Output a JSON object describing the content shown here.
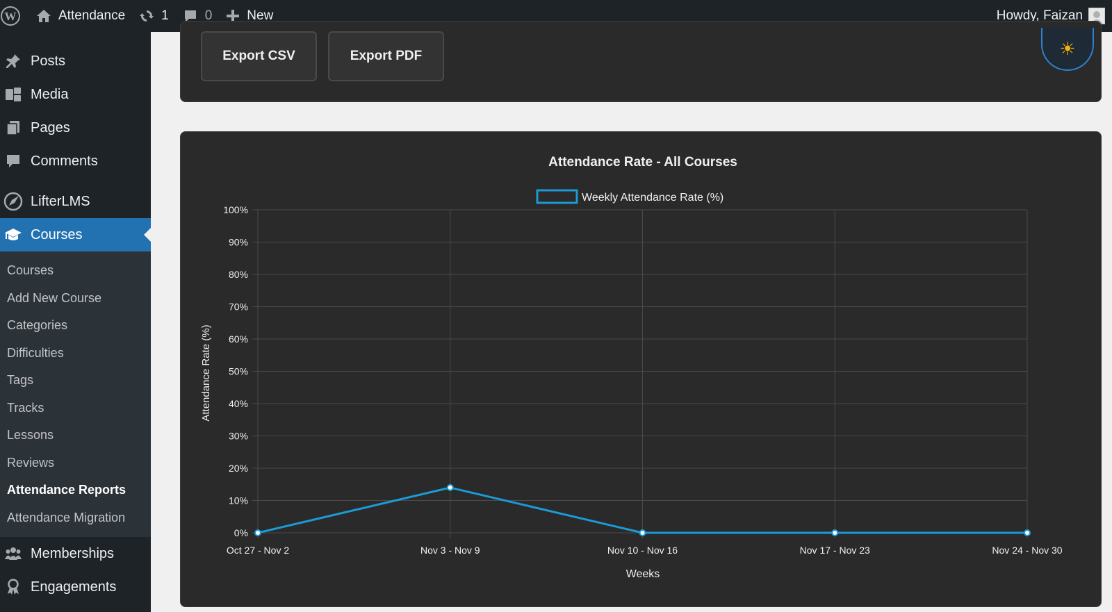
{
  "adminbar": {
    "site_name": "Attendance",
    "updates_count": "1",
    "comments_count": "0",
    "new_label": "New",
    "howdy": "Howdy, Faizan"
  },
  "sidebar": {
    "items_top": [
      {
        "label": "Posts",
        "icon": "pushpin-icon"
      },
      {
        "label": "Media",
        "icon": "media-icon"
      },
      {
        "label": "Pages",
        "icon": "pages-icon"
      },
      {
        "label": "Comments",
        "icon": "comment-icon"
      }
    ],
    "lifterlms": {
      "label": "LifterLMS",
      "icon": "rocket-icon"
    },
    "courses": {
      "label": "Courses",
      "icon": "graduation-cap-icon"
    },
    "submenu": [
      {
        "label": "Courses"
      },
      {
        "label": "Add New Course"
      },
      {
        "label": "Categories"
      },
      {
        "label": "Difficulties"
      },
      {
        "label": "Tags"
      },
      {
        "label": "Tracks"
      },
      {
        "label": "Lessons"
      },
      {
        "label": "Reviews"
      },
      {
        "label": "Attendance Reports"
      },
      {
        "label": "Attendance Migration"
      }
    ],
    "items_bottom": [
      {
        "label": "Memberships",
        "icon": "groups-icon"
      },
      {
        "label": "Engagements",
        "icon": "awards-icon"
      }
    ]
  },
  "toolbar": {
    "export_csv": "Export CSV",
    "export_pdf": "Export PDF",
    "theme_icon": "sun-icon"
  },
  "colors": {
    "accent": "#2271b1",
    "line": "#1a9bd7",
    "panel": "#2a2a2a"
  },
  "chart_data": {
    "type": "line",
    "title": "Attendance Rate - All Courses",
    "xlabel": "Weeks",
    "ylabel": "Attendance Rate (%)",
    "categories": [
      "Oct 27 - Nov 2",
      "Nov 3 - Nov 9",
      "Nov 10 - Nov 16",
      "Nov 17 - Nov 23",
      "Nov 24 - Nov 30"
    ],
    "series": [
      {
        "name": "Weekly Attendance Rate (%)",
        "values": [
          0,
          14,
          0,
          0,
          0
        ]
      }
    ],
    "ylim": [
      0,
      100
    ],
    "yticks": [
      "0%",
      "10%",
      "20%",
      "30%",
      "40%",
      "50%",
      "60%",
      "70%",
      "80%",
      "90%",
      "100%"
    ],
    "grid": true,
    "legend": "top"
  }
}
